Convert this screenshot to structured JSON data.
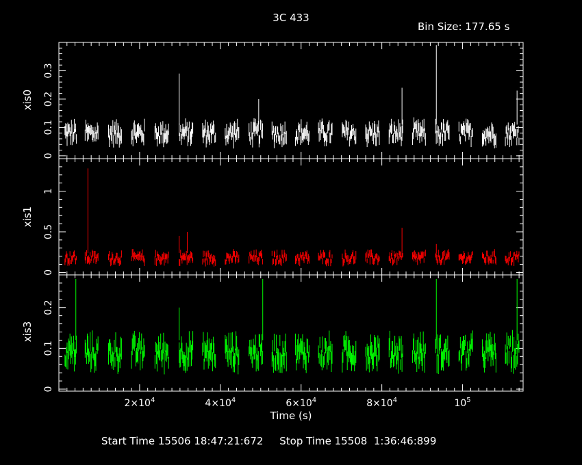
{
  "header": {
    "title": "3C 433",
    "bin_size_label": "Bin Size: 177.65 s"
  },
  "footer": {
    "times": "Start Time 15506 18:47:21:672     Stop Time 15508  1:36:46:899"
  },
  "chart_data": [
    {
      "type": "scatter",
      "instrument": "xis0",
      "ylabel": "xis0",
      "color": "#ffffff",
      "xlim": [
        0,
        115000
      ],
      "ylim": [
        -0.01,
        0.4
      ],
      "yticks": [
        0,
        0.1,
        0.2,
        0.3
      ],
      "ytick_labels": [
        "0",
        "0.1",
        "0.2",
        "0.3"
      ],
      "typical_rate": 0.08,
      "typical_spread": 0.03,
      "spikes": [
        {
          "x": 29800,
          "y": 0.29
        },
        {
          "x": 49500,
          "y": 0.2
        },
        {
          "x": 85000,
          "y": 0.24
        },
        {
          "x": 93500,
          "y": 0.39
        },
        {
          "x": 113500,
          "y": 0.23
        }
      ]
    },
    {
      "type": "scatter",
      "instrument": "xis1",
      "ylabel": "xis1",
      "color": "#ff0000",
      "xlim": [
        0,
        115000
      ],
      "ylim": [
        -0.03,
        1.4
      ],
      "yticks": [
        0,
        0.5,
        1
      ],
      "ytick_labels": [
        "0",
        "0.5",
        "1"
      ],
      "typical_rate": 0.18,
      "typical_spread": 0.06,
      "spikes": [
        {
          "x": 7200,
          "y": 1.28
        },
        {
          "x": 29800,
          "y": 0.45
        },
        {
          "x": 31800,
          "y": 0.5
        },
        {
          "x": 85000,
          "y": 0.55
        },
        {
          "x": 93500,
          "y": 0.35
        }
      ]
    },
    {
      "type": "scatter",
      "instrument": "xis3",
      "ylabel": "xis3",
      "color": "#00ff00",
      "xlim": [
        0,
        115000
      ],
      "ylim": [
        -0.005,
        0.28
      ],
      "yticks": [
        0,
        0.1,
        0.2
      ],
      "ytick_labels": [
        "0",
        "0.1",
        "0.2"
      ],
      "xticks": [
        20000,
        40000,
        60000,
        80000,
        100000
      ],
      "xlabel": "Time (s)",
      "typical_rate": 0.09,
      "typical_spread": 0.03,
      "spikes": [
        {
          "x": 4200,
          "y": 0.27
        },
        {
          "x": 29800,
          "y": 0.2
        },
        {
          "x": 50500,
          "y": 0.27
        },
        {
          "x": 93500,
          "y": 0.27
        },
        {
          "x": 113500,
          "y": 0.27
        }
      ]
    }
  ],
  "segments": [
    [
      1500,
      4500
    ],
    [
      6500,
      9800
    ],
    [
      12300,
      15500
    ],
    [
      18000,
      21200
    ],
    [
      23800,
      27200
    ],
    [
      29800,
      33200
    ],
    [
      35600,
      38900
    ],
    [
      41200,
      44700
    ],
    [
      47100,
      50600
    ],
    [
      52800,
      56400
    ],
    [
      58600,
      62100
    ],
    [
      64300,
      67800
    ],
    [
      70200,
      73600
    ],
    [
      76000,
      79400
    ],
    [
      81800,
      85200
    ],
    [
      87600,
      90900
    ],
    [
      93300,
      96800
    ],
    [
      99100,
      102500
    ],
    [
      104900,
      108400
    ],
    [
      110600,
      114100
    ]
  ]
}
